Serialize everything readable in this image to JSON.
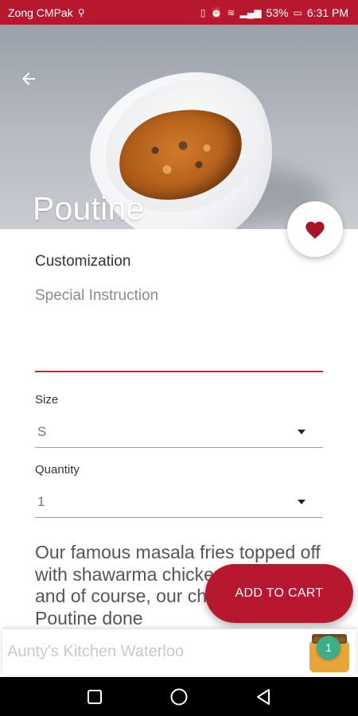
{
  "status_bar": {
    "carrier": "Zong CMPak",
    "battery": "53%",
    "time": "6:31 PM"
  },
  "header": {
    "back_icon": "arrow-left-icon",
    "title": "Poutine"
  },
  "favorite": {
    "icon": "heart-icon",
    "color": "#b8182f"
  },
  "customization": {
    "title": "Customization",
    "instruction_label": "Special Instruction",
    "instruction_value": ""
  },
  "size": {
    "label": "Size",
    "value": "S"
  },
  "quantity": {
    "label": "Quantity",
    "value": "1"
  },
  "description": "Our famous masala fries topped off with shawarma chicken, cheese, and of course, our chicken sauce. Poutine done",
  "add_to_cart": {
    "label": "ADD TO CART",
    "color": "#b8182f"
  },
  "restaurant": {
    "name": "Aunty's Kitchen Waterloo",
    "cart_count": "1"
  },
  "colors": {
    "primary": "#b8182f",
    "badge": "#3dae8a"
  }
}
